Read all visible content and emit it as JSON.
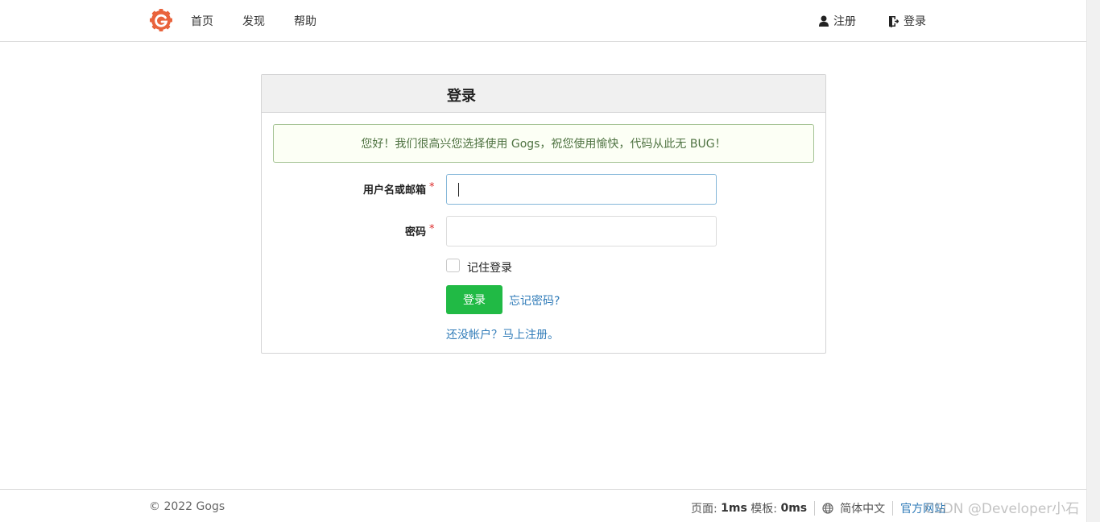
{
  "nav": {
    "home": "首页",
    "explore": "发现",
    "help": "帮助",
    "register": "注册",
    "login": "登录"
  },
  "card": {
    "title": "登录",
    "message": "您好！我们很高兴您选择使用 Gogs，祝您使用愉快，代码从此无 BUG！",
    "username_label": "用户名或邮箱",
    "password_label": "密码",
    "required_mark": "*",
    "remember_label": "记住登录",
    "login_button": "登录",
    "forgot_link": "忘记密码?",
    "signup_link": "还没帐户？马上注册。"
  },
  "inputs": {
    "username_value": "",
    "password_value": ""
  },
  "footer": {
    "copyright": "© 2022 Gogs",
    "page_label": "页面:",
    "page_time": "1ms",
    "template_label": "模板:",
    "template_time": "0ms",
    "language": "简体中文",
    "official_site": "官方网站",
    "watermark": "CSDN @Developer小石"
  },
  "colors": {
    "logo": "#e9633c",
    "primary_button": "#21ba45",
    "link": "#2f7bb8",
    "message_border": "#a3c293",
    "message_text": "#4f7342"
  },
  "icons": {
    "logo": "gogs-logo-icon",
    "register": "user-icon",
    "login": "sign-in-icon",
    "language": "globe-icon"
  }
}
